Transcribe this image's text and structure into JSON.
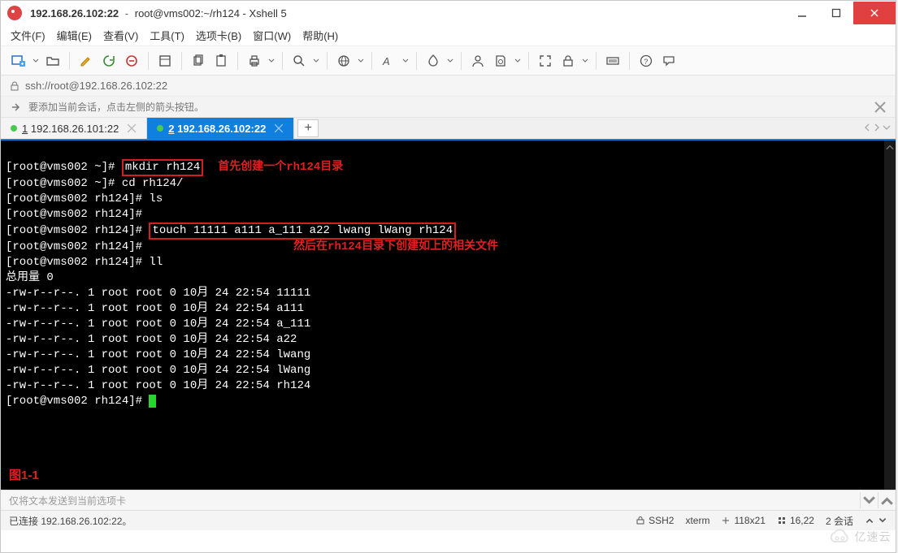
{
  "title": {
    "address": "192.168.26.102:22",
    "session": "root@vms002:~/rh124 - Xshell 5"
  },
  "menu": {
    "file": "文件(F)",
    "edit": "编辑(E)",
    "view": "查看(V)",
    "tools": "工具(T)",
    "option": "选项卡(B)",
    "window": "窗口(W)",
    "help": "帮助(H)"
  },
  "addr": {
    "url": "ssh://root@192.168.26.102:22"
  },
  "hint": {
    "text": "要添加当前会话，点击左侧的箭头按钮。"
  },
  "tabs": {
    "t1": {
      "index": "1",
      "label": "192.168.26.101:22"
    },
    "t2": {
      "index": "2",
      "label": "192.168.26.102:22"
    },
    "new": "+"
  },
  "term": {
    "p1a": "[root@vms002 ~]# ",
    "p1cmd": "mkdir rh124",
    "p1ann": "首先创建一个rh124目录",
    "p2": "[root@vms002 ~]# cd rh124/",
    "p3": "[root@vms002 rh124]# ls",
    "p4": "[root@vms002 rh124]#",
    "p5a": "[root@vms002 rh124]# ",
    "p5cmd": "touch 11111 a111 a_111 a22 lwang lWang rh124",
    "p6": "[root@vms002 rh124]#",
    "p6ann": "然后在rh124目录下创建如上的相关文件",
    "p7": "[root@vms002 rh124]# ll",
    "total": "总用量 0",
    "l1": "-rw-r--r--. 1 root root 0 10月 24 22:54 11111",
    "l2": "-rw-r--r--. 1 root root 0 10月 24 22:54 a111",
    "l3": "-rw-r--r--. 1 root root 0 10月 24 22:54 a_111",
    "l4": "-rw-r--r--. 1 root root 0 10月 24 22:54 a22",
    "l5": "-rw-r--r--. 1 root root 0 10月 24 22:54 lwang",
    "l6": "-rw-r--r--. 1 root root 0 10月 24 22:54 lWang",
    "l7": "-rw-r--r--. 1 root root 0 10月 24 22:54 rh124",
    "p8": "[root@vms002 rh124]# ",
    "figlabel": "图1-1"
  },
  "inputline": {
    "placeholder": "仅将文本发送到当前选项卡"
  },
  "status": {
    "conn": "已连接 192.168.26.102:22。",
    "proto": "SSH2",
    "termtype": "xterm",
    "size": "118x21",
    "cursor": "16,22",
    "sessions": "2 会话"
  },
  "watermark": {
    "text": "亿速云"
  }
}
